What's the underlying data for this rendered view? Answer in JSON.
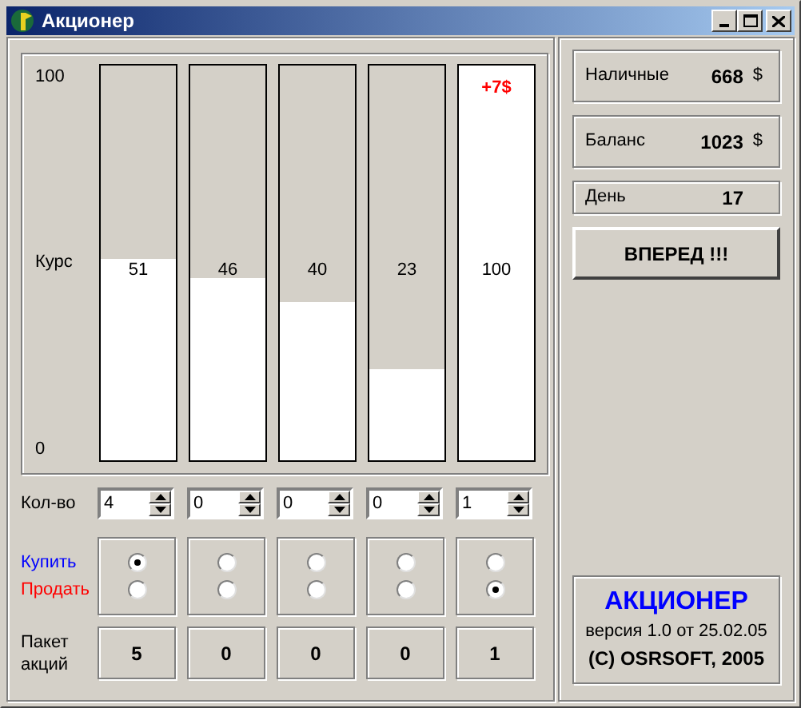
{
  "window": {
    "title": "Акционер"
  },
  "scale": {
    "max": "100",
    "label": "Курс",
    "min": "0"
  },
  "stocks": [
    {
      "price": "51",
      "level": 0.51,
      "quantity": "4",
      "radios": [
        {
          "selected": true
        },
        {
          "selected": false
        }
      ],
      "holdings": "5"
    },
    {
      "price": "46",
      "level": 0.46,
      "quantity": "0",
      "radios": [
        {
          "selected": false
        },
        {
          "selected": false
        }
      ],
      "holdings": "0"
    },
    {
      "price": "40",
      "level": 0.4,
      "quantity": "0",
      "radios": [
        {
          "selected": false
        },
        {
          "selected": false
        }
      ],
      "holdings": "0"
    },
    {
      "price": "23",
      "level": 0.23,
      "quantity": "0",
      "radios": [
        {
          "selected": false
        },
        {
          "selected": false
        }
      ],
      "holdings": "0"
    },
    {
      "price": "100",
      "level": 1,
      "change": "+7$",
      "quantity": "1",
      "radios": [
        {
          "selected": false
        },
        {
          "selected": true
        }
      ],
      "holdings": "1"
    }
  ],
  "row_labels": {
    "quantity": "Кол-во",
    "buy": "Купить",
    "sell": "Продать",
    "holdings": "Пакет акций"
  },
  "stats": [
    {
      "label": "Наличные",
      "value": "668",
      "unit": "$"
    },
    {
      "label": "Баланс",
      "value": "1023",
      "unit": "$"
    },
    {
      "label": "День",
      "value": "17"
    }
  ],
  "next_button": "ВПЕРЕД !!!",
  "about": {
    "title": "АКЦИОНЕР",
    "version": "версия 1.0 от 25.02.05",
    "copyright": "(C) OSRSOFT, 2005"
  }
}
